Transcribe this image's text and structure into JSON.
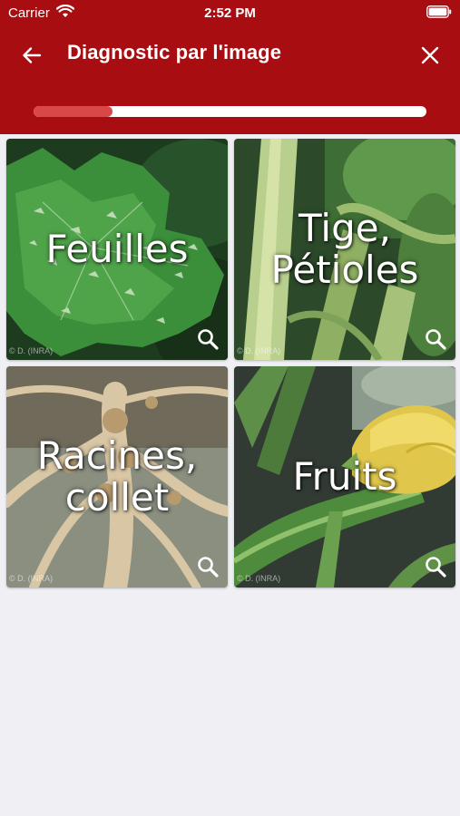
{
  "status_bar": {
    "carrier": "Carrier",
    "time": "2:52 PM"
  },
  "header": {
    "title": "Diagnostic par l'image",
    "back_icon": "arrow-left-icon",
    "close_icon": "close-icon"
  },
  "progress": {
    "fraction": 0.2,
    "track_color": "#ffffff",
    "fill_color": "#d84848"
  },
  "colors": {
    "header_bg": "#a80d12",
    "page_bg": "#efeff4"
  },
  "categories": [
    {
      "label": "Feuilles",
      "credit": "© D. (INRA)",
      "icon": "zoom-icon"
    },
    {
      "label": "Tige,\nPétioles",
      "credit": "© D. (INRA)",
      "icon": "zoom-icon"
    },
    {
      "label": "Racines,\ncollet",
      "credit": "© D. (INRA)",
      "icon": "zoom-icon"
    },
    {
      "label": "Fruits",
      "credit": "© D. (INRA)",
      "icon": "zoom-icon"
    }
  ]
}
